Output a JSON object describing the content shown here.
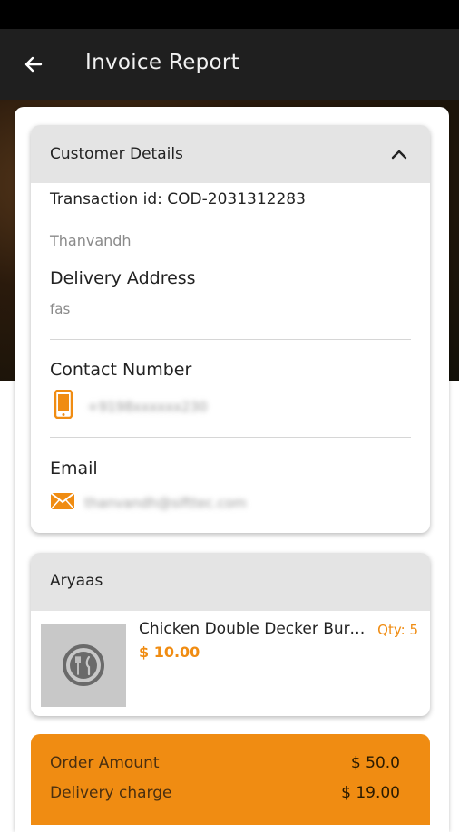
{
  "app_bar": {
    "title": "Invoice Report"
  },
  "customer_card": {
    "header_label": "Customer Details",
    "transaction": "Transaction id: COD-2031312283",
    "customer_name": "Thanvandh",
    "delivery_address_title": "Delivery Address",
    "delivery_address_value": "fas",
    "contact_title": "Contact Number",
    "contact_value": "+9198xxxxxx230",
    "email_title": "Email",
    "email_value": "thanvandh@sifttec.com"
  },
  "restaurant_card": {
    "header_label": "Aryaas",
    "item": {
      "name": "Chicken Double Decker Burger",
      "qty": "Qty: 5",
      "price": "$ 10.00"
    }
  },
  "summary": {
    "order_amount_label": "Order Amount",
    "order_amount_value": "$ 50.0",
    "delivery_charge_label": "Delivery charge",
    "delivery_charge_value": "$ 19.00"
  },
  "colors": {
    "accent": "#f08c12",
    "app_bar": "#1f1f1f",
    "header_gray": "#e4e4e4"
  }
}
